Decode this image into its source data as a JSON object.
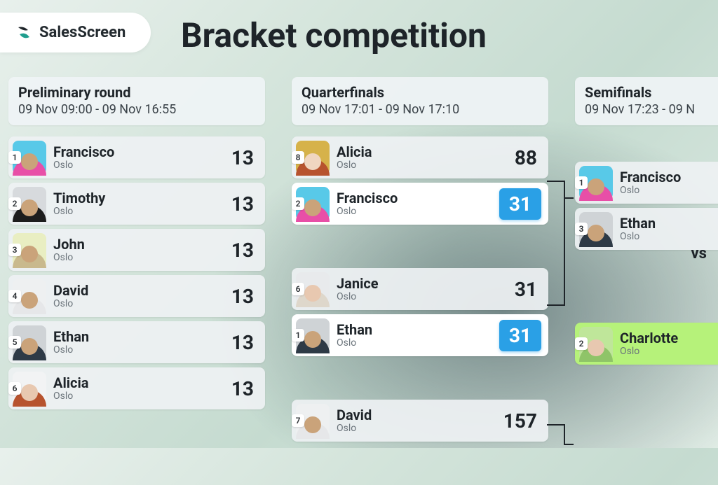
{
  "brand": {
    "name": "SalesScreen"
  },
  "page_title": "Bracket competition",
  "vs_label": "vs",
  "rounds": {
    "prelim": {
      "name": "Preliminary round",
      "dates": "09 Nov 09:00 - 09 Nov 16:55",
      "players": [
        {
          "seed": "1",
          "name": "Francisco",
          "loc": "Oslo",
          "score": "13",
          "av_bg": "#58c9e8",
          "body": "#e84fa7"
        },
        {
          "seed": "2",
          "name": "Timothy",
          "loc": "Oslo",
          "score": "13",
          "av_bg": "#d7dadd",
          "body": "#1d1d1d"
        },
        {
          "seed": "3",
          "name": "John",
          "loc": "Oslo",
          "score": "13",
          "av_bg": "#e9eec2",
          "body": "#c9b98d"
        },
        {
          "seed": "4",
          "name": "David",
          "loc": "Oslo",
          "score": "13",
          "av_bg": "#eef0f1",
          "body": "#e6e7e9"
        },
        {
          "seed": "5",
          "name": "Ethan",
          "loc": "Oslo",
          "score": "13",
          "av_bg": "#cfd3d6",
          "body": "#2e3a46"
        },
        {
          "seed": "6",
          "name": "Alicia",
          "loc": "Oslo",
          "score": "13",
          "av_bg": "#f2f3f4",
          "body": "#b7532e",
          "head": "#e8c8b0"
        }
      ]
    },
    "qf": {
      "name": "Quarterfinals",
      "dates": "09 Nov 17:01 - 09 Nov 17:10",
      "matches": [
        [
          {
            "seed": "8",
            "name": "Alicia",
            "loc": "Oslo",
            "score": "88",
            "av_bg": "#d6b24a",
            "body": "#b7532e",
            "head": "#f0d6c0"
          },
          {
            "seed": "2",
            "name": "Francisco",
            "loc": "Oslo",
            "score": "31",
            "av_bg": "#58c9e8",
            "body": "#e84fa7",
            "sel": "blue"
          }
        ],
        [
          {
            "seed": "6",
            "name": "Janice",
            "loc": "Oslo",
            "score": "31",
            "av_bg": "#e8eaec",
            "body": "#ded7cb",
            "head": "#e8c8b0"
          },
          {
            "seed": "1",
            "name": "Ethan",
            "loc": "Oslo",
            "score": "31",
            "av_bg": "#cfd3d6",
            "body": "#2e3a46",
            "sel": "blue"
          }
        ],
        [
          {
            "seed": "7",
            "name": "David",
            "loc": "Oslo",
            "score": "157",
            "av_bg": "#eef0f1",
            "body": "#e6e7e9"
          }
        ]
      ]
    },
    "semi": {
      "name": "Semifinals",
      "dates": "09 Nov 17:23 - 09 N",
      "matches": [
        [
          {
            "seed": "1",
            "name": "Francisco",
            "loc": "Oslo",
            "av_bg": "#58c9e8",
            "body": "#e84fa7"
          },
          {
            "seed": "3",
            "name": "Ethan",
            "loc": "Oslo",
            "av_bg": "#cfd3d6",
            "body": "#2e3a46"
          }
        ],
        [
          {
            "seed": "2",
            "name": "Charlotte",
            "loc": "Oslo",
            "av_bg": "#bfe69a",
            "body": "#8fc468",
            "head": "#e8c8b0",
            "sel": "green"
          }
        ]
      ]
    }
  }
}
